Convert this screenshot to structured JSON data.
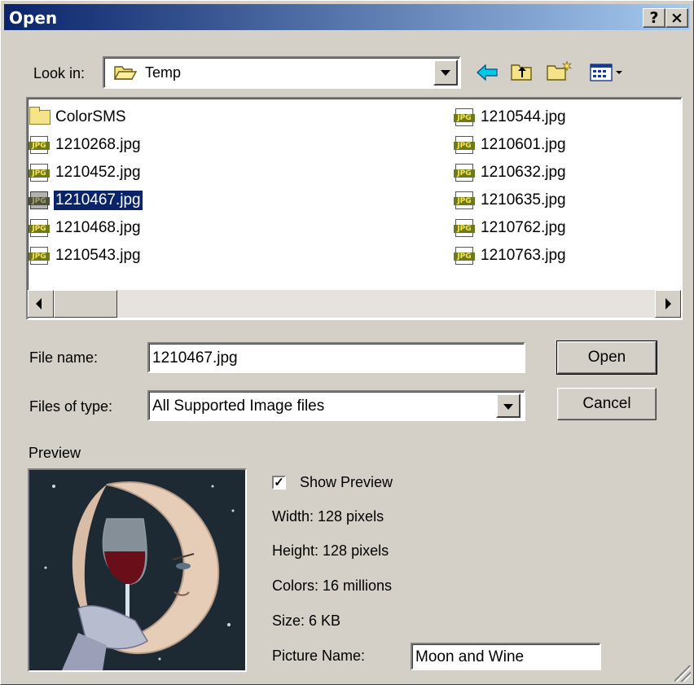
{
  "window": {
    "title": "Open",
    "help_label": "?",
    "close_label": "×"
  },
  "look_in": {
    "label": "Look in:",
    "value": "Temp"
  },
  "files": {
    "left": [
      {
        "name": "ColorSMS",
        "type": "folder"
      },
      {
        "name": "1210268.jpg",
        "type": "jpg"
      },
      {
        "name": "1210452.jpg",
        "type": "jpg"
      },
      {
        "name": "1210467.jpg",
        "type": "jpg",
        "selected": true
      },
      {
        "name": "1210468.jpg",
        "type": "jpg"
      },
      {
        "name": "1210543.jpg",
        "type": "jpg"
      }
    ],
    "right": [
      {
        "name": "1210544.jpg",
        "type": "jpg"
      },
      {
        "name": "1210601.jpg",
        "type": "jpg"
      },
      {
        "name": "1210632.jpg",
        "type": "jpg"
      },
      {
        "name": "1210635.jpg",
        "type": "jpg"
      },
      {
        "name": "1210762.jpg",
        "type": "jpg"
      },
      {
        "name": "1210763.jpg",
        "type": "jpg"
      }
    ]
  },
  "file_name": {
    "label": "File name:",
    "value": "1210467.jpg"
  },
  "file_type": {
    "label": "Files of type:",
    "value": "All Supported Image files"
  },
  "buttons": {
    "open": "Open",
    "cancel": "Cancel"
  },
  "preview": {
    "label": "Preview",
    "show_preview_label": "Show Preview",
    "show_preview_checked": true,
    "width": "Width: 128 pixels",
    "height": "Height: 128 pixels",
    "colors": "Colors: 16 millions",
    "size": "Size: 6 KB",
    "picture_name_label": "Picture Name:",
    "picture_name_value": "Moon and Wine"
  },
  "colors": {
    "title_start": "#0a246a",
    "title_end": "#a6caf0",
    "selection": "#0a246a",
    "face": "#d4d0c8"
  }
}
